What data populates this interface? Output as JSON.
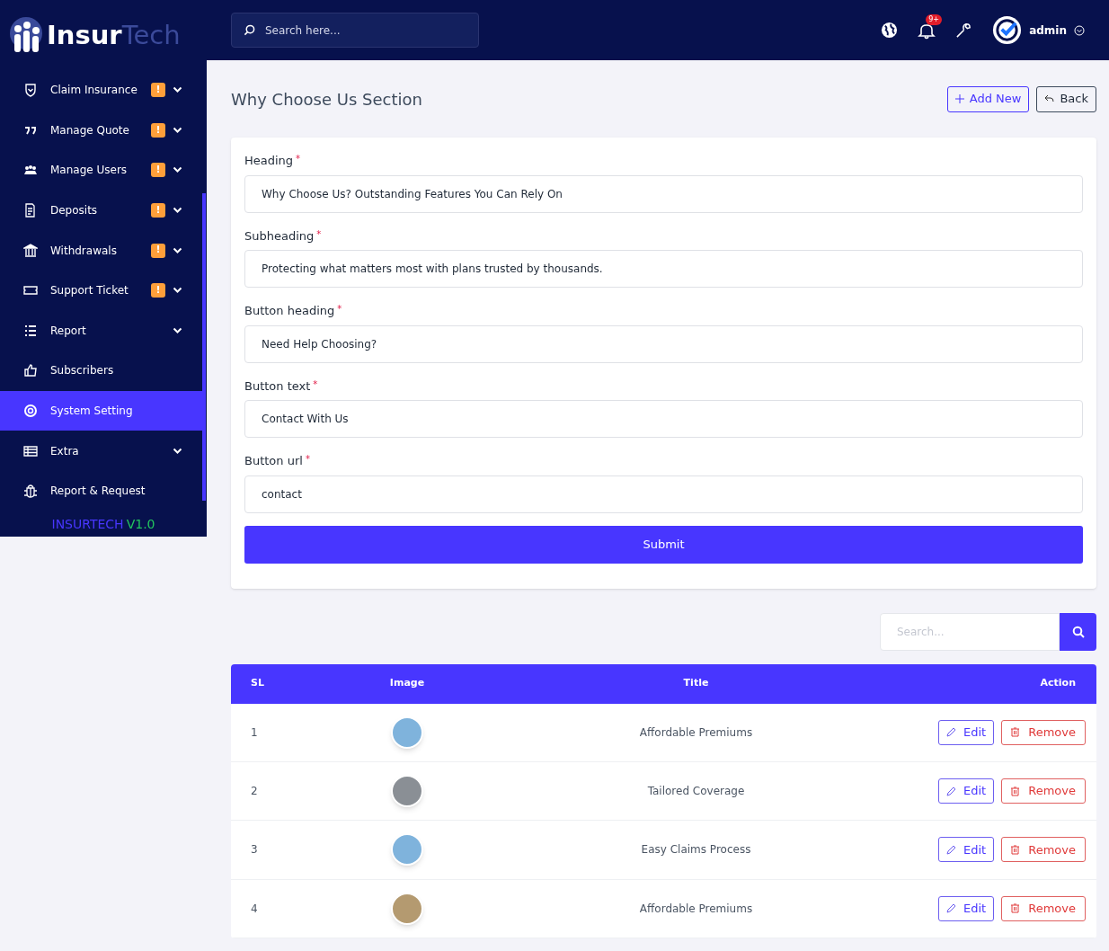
{
  "logo": {
    "part_1": "Insur",
    "part_2": "Tech"
  },
  "sidebar": {
    "items": [
      {
        "label": "Claim Insurance",
        "badge": "!",
        "expandable": true,
        "selected": false
      },
      {
        "label": "Manage Quote",
        "badge": "!",
        "expandable": true,
        "selected": false
      },
      {
        "label": "Manage Users",
        "badge": "!",
        "expandable": true,
        "selected": false
      },
      {
        "label": "Deposits",
        "badge": "!",
        "expandable": true,
        "selected": false
      },
      {
        "label": "Withdrawals",
        "badge": "!",
        "expandable": true,
        "selected": false
      },
      {
        "label": "Support Ticket",
        "badge": "!",
        "expandable": true,
        "selected": false
      },
      {
        "label": "Report",
        "expandable": true,
        "selected": false
      },
      {
        "label": "Subscribers",
        "expandable": false,
        "selected": false
      },
      {
        "label": "System Setting",
        "expandable": false,
        "selected": true
      },
      {
        "label": "Extra",
        "expandable": true,
        "selected": false
      },
      {
        "label": "Report & Request",
        "expandable": false,
        "selected": false
      }
    ],
    "footer": {
      "name": "INSURTECH",
      "version": "V1.0"
    }
  },
  "topbar": {
    "search": {
      "placeholder": "Search here..."
    },
    "notification_count": "9+",
    "user": "admin"
  },
  "page": {
    "title": "Why Choose Us Section",
    "buttons": [
      "Add New",
      "Back"
    ]
  },
  "form": {
    "fields": [
      {
        "label": "Heading",
        "required_mark": "*",
        "value": "Why Choose Us? Outstanding Features You Can Rely On"
      },
      {
        "label": "Subheading",
        "required_mark": "*",
        "value": "Protecting what matters most with plans trusted by thousands."
      },
      {
        "label": "Button heading",
        "required_mark": "*",
        "value": "Need Help Choosing?"
      },
      {
        "label": "Button text",
        "required_mark": "*",
        "value": "Contact With Us"
      },
      {
        "label": "Button url",
        "required_mark": "*",
        "value": "contact"
      }
    ],
    "submit": "Submit"
  },
  "table_search": {
    "placeholder": "Search..."
  },
  "table": {
    "columns": [
      "SL",
      "Image",
      "Title",
      "Action"
    ],
    "rows": [
      {
        "sl": "1",
        "title": "Affordable Premiums",
        "actions": [
          "Edit",
          "Remove"
        ]
      },
      {
        "sl": "2",
        "title": "Tailored Coverage",
        "actions": [
          "Edit",
          "Remove"
        ]
      },
      {
        "sl": "3",
        "title": "Easy Claims Process",
        "actions": [
          "Edit",
          "Remove"
        ]
      },
      {
        "sl": "4",
        "title": "Affordable Premiums",
        "actions": [
          "Edit",
          "Remove"
        ]
      }
    ]
  }
}
